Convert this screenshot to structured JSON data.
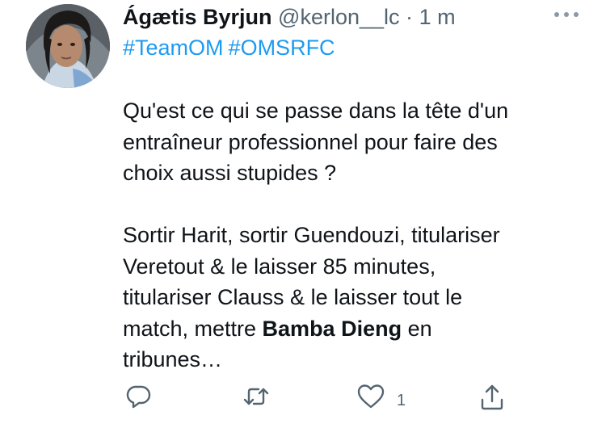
{
  "tweet": {
    "author_name": "Ágætis Byrjun",
    "handle": "@kerlon__lc",
    "separator": "·",
    "time": "1 m",
    "hashtags": [
      "#TeamOM",
      "#OMSRFC"
    ],
    "paragraph1": [
      "Qu'est ce qui se passe dans la tête d'un",
      "entraîneur professionnel pour faire des",
      "choix aussi stupides ?"
    ],
    "paragraph2": {
      "line1": "Sortir Harit, sortir Guendouzi, titulariser",
      "line2": "Veretout & le laisser 85 minutes,",
      "line3": "titulariser Clauss & le laisser tout le",
      "line4_before": "match, mettre ",
      "line4_bold": "Bamba Dieng",
      "line4_after": " en",
      "line5": "tribunes…"
    },
    "like_count": "1"
  },
  "icons": {
    "more": "more-dots-icon",
    "reply": "reply-icon",
    "retweet": "retweet-icon",
    "like": "heart-icon",
    "share": "share-icon"
  },
  "colors": {
    "text": "#0f1419",
    "secondary": "#536471",
    "link": "#1d9bf0",
    "background": "#ffffff"
  }
}
